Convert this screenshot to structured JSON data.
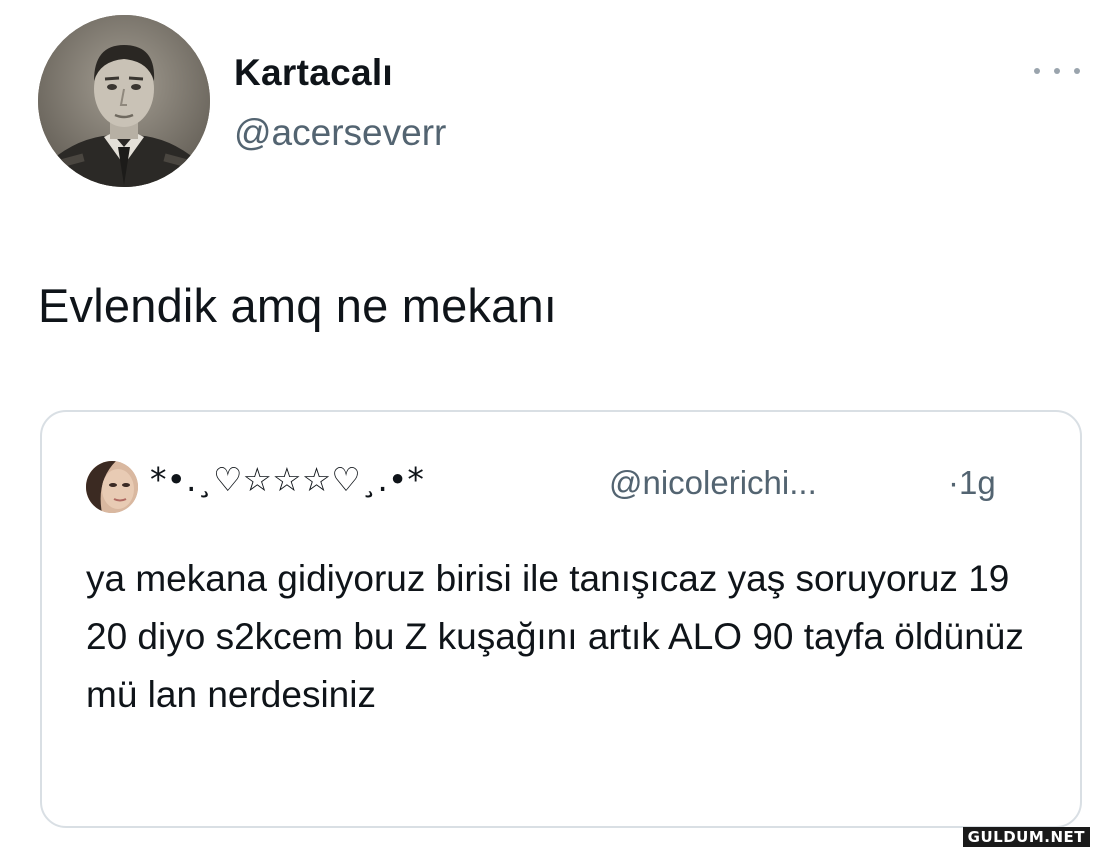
{
  "author": {
    "display_name": "Kartacalı",
    "handle": "@acerseverr",
    "avatar_icon": "profile-photo-vintage-man"
  },
  "tweet": {
    "text": "Evlendik amq ne mekanı"
  },
  "quoted_tweet": {
    "display_name": "*•.¸♡☆☆☆♡¸.•*",
    "handle": "@nicolerichi...",
    "time": "·1g",
    "text": "ya mekana gidiyoruz birisi ile tanışıcaz yaş soruyoruz 19 20 diyo s2kcem bu Z kuşağını artık ALO 90 tayfa öldünüz mü lan nerdesiniz"
  },
  "watermark": "GULDUM.NET",
  "colors": {
    "text_primary": "#0f1419",
    "text_secondary": "#536471",
    "border": "#d9dfe4"
  }
}
